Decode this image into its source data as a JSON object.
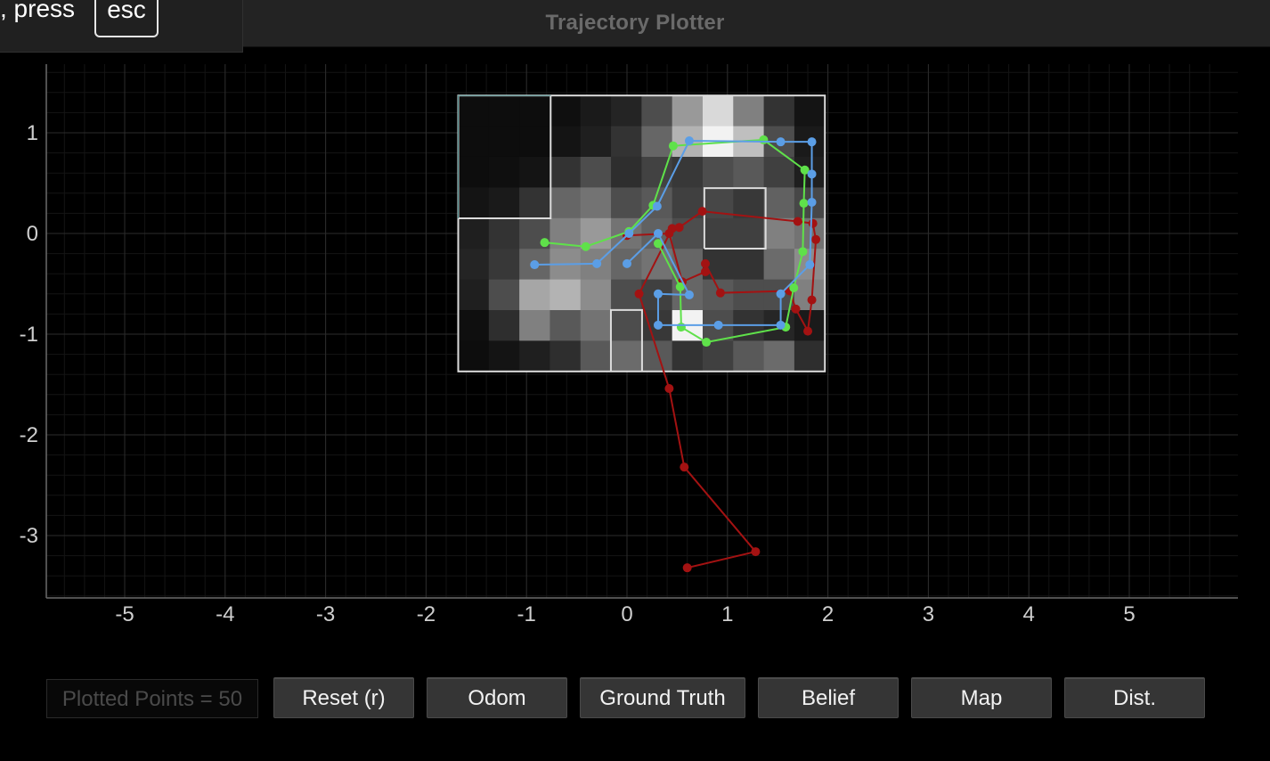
{
  "window": {
    "title": "Trajectory Plotter"
  },
  "hint": {
    "text": ", press",
    "key": "esc"
  },
  "counter": {
    "text": "Plotted Points = 50"
  },
  "buttons": [
    {
      "label": "Reset (r)"
    },
    {
      "label": "Odom"
    },
    {
      "label": "Ground Truth"
    },
    {
      "label": "Belief"
    },
    {
      "label": "Map"
    },
    {
      "label": "Dist."
    }
  ],
  "chart_data": {
    "type": "line",
    "xlim": [
      -5.8,
      6.0
    ],
    "ylim": [
      -3.6,
      1.65
    ],
    "x_ticks": [
      -5,
      -4,
      -3,
      -2,
      -1,
      0,
      1,
      2,
      3,
      4,
      5
    ],
    "y_ticks": [
      1,
      0,
      -1,
      -2,
      -3
    ],
    "grid": true,
    "colors": {
      "odom": "#a31212",
      "ground_truth": "#5fe14a",
      "belief": "#5b9ee6",
      "map": "#dddddd"
    },
    "series": [
      {
        "color": "#a31212",
        "points": [
          [
            0.6,
            -3.32
          ],
          [
            1.28,
            -3.16
          ],
          [
            0.57,
            -2.32
          ],
          [
            0.42,
            -1.54
          ],
          [
            0.12,
            -0.6
          ],
          [
            0.45,
            0.05
          ],
          [
            0.52,
            0.06
          ],
          [
            0.75,
            0.22
          ],
          [
            1.7,
            0.12
          ],
          [
            1.85,
            0.1
          ],
          [
            1.88,
            -0.06
          ],
          [
            1.84,
            -0.66
          ],
          [
            1.8,
            -0.97
          ],
          [
            1.68,
            -0.75
          ],
          [
            1.62,
            -0.57
          ],
          [
            0.93,
            -0.59
          ],
          [
            0.78,
            -0.3
          ],
          [
            0.78,
            -0.38
          ],
          [
            0.55,
            -0.48
          ],
          [
            0.42,
            0.0
          ],
          [
            0.0,
            -0.02
          ]
        ]
      },
      {
        "color": "#5fe14a",
        "points": [
          [
            -0.82,
            -0.09
          ],
          [
            -0.41,
            -0.13
          ],
          [
            0.02,
            0.02
          ],
          [
            0.26,
            0.28
          ],
          [
            0.46,
            0.87
          ],
          [
            1.36,
            0.93
          ],
          [
            1.77,
            0.63
          ],
          [
            1.76,
            0.3
          ],
          [
            1.75,
            -0.18
          ],
          [
            1.66,
            -0.54
          ],
          [
            1.58,
            -0.93
          ],
          [
            0.79,
            -1.08
          ],
          [
            0.54,
            -0.93
          ],
          [
            0.53,
            -0.53
          ],
          [
            0.31,
            -0.1
          ]
        ]
      },
      {
        "color": "#5b9ee6",
        "points": [
          [
            -0.92,
            -0.31
          ],
          [
            -0.3,
            -0.3
          ],
          [
            0.02,
            0.0
          ],
          [
            0.3,
            0.27
          ],
          [
            0.62,
            0.92
          ],
          [
            1.53,
            0.91
          ],
          [
            1.84,
            0.91
          ],
          [
            1.84,
            0.59
          ],
          [
            1.84,
            0.31
          ],
          [
            1.82,
            -0.31
          ],
          [
            1.53,
            -0.6
          ],
          [
            1.53,
            -0.91
          ],
          [
            0.91,
            -0.91
          ],
          [
            0.31,
            -0.91
          ],
          [
            0.31,
            -0.6
          ],
          [
            0.62,
            -0.61
          ],
          [
            0.31,
            0.0
          ],
          [
            0.0,
            -0.3
          ]
        ]
      }
    ],
    "map": {
      "bounds": {
        "xmin": -1.68,
        "xmax": 1.97,
        "ymin": -1.37,
        "ymax": 1.37
      },
      "cell_size": 0.3,
      "cols": 12,
      "rows": 9,
      "intensity": [
        [
          0.05,
          0.05,
          0.05,
          0.06,
          0.1,
          0.14,
          0.3,
          0.6,
          0.85,
          0.5,
          0.2,
          0.08
        ],
        [
          0.05,
          0.05,
          0.05,
          0.08,
          0.12,
          0.2,
          0.4,
          0.7,
          0.95,
          0.75,
          0.3,
          0.1
        ],
        [
          0.05,
          0.06,
          0.08,
          0.2,
          0.3,
          0.18,
          0.26,
          0.22,
          0.3,
          0.35,
          0.25,
          0.12
        ],
        [
          0.08,
          0.1,
          0.2,
          0.4,
          0.45,
          0.3,
          0.35,
          0.25,
          0.28,
          0.22,
          0.38,
          0.28
        ],
        [
          0.12,
          0.2,
          0.3,
          0.5,
          0.6,
          0.45,
          0.38,
          0.3,
          0.25,
          0.25,
          0.5,
          0.45
        ],
        [
          0.14,
          0.22,
          0.4,
          0.55,
          0.5,
          0.4,
          0.45,
          0.4,
          0.2,
          0.2,
          0.42,
          0.55
        ],
        [
          0.12,
          0.3,
          0.65,
          0.7,
          0.55,
          0.3,
          0.25,
          0.4,
          0.35,
          0.3,
          0.3,
          0.5
        ],
        [
          0.06,
          0.18,
          0.5,
          0.35,
          0.45,
          0.3,
          0.22,
          0.95,
          0.3,
          0.2,
          0.15,
          0.1
        ],
        [
          0.05,
          0.08,
          0.12,
          0.18,
          0.35,
          0.42,
          0.35,
          0.2,
          0.25,
          0.35,
          0.42,
          0.18
        ]
      ],
      "walls": [
        [
          [
            -1.68,
            0.15
          ],
          [
            -0.76,
            0.15
          ],
          [
            -0.76,
            1.37
          ]
        ],
        [
          [
            0.77,
            -0.15
          ],
          [
            1.38,
            -0.15
          ],
          [
            1.38,
            0.45
          ],
          [
            0.77,
            0.45
          ],
          [
            0.77,
            -0.15
          ]
        ],
        [
          [
            -0.16,
            -1.37
          ],
          [
            -0.16,
            -0.76
          ],
          [
            0.15,
            -0.76
          ],
          [
            0.15,
            -1.37
          ]
        ]
      ]
    }
  }
}
